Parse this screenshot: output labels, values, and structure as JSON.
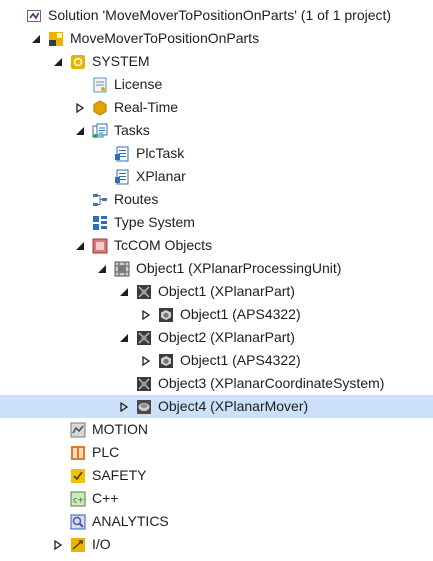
{
  "tree": [
    {
      "name": "tree-item-solution",
      "label": "Solution 'MoveMoverToPositionOnParts' (1 of 1 project)",
      "icon": "solution-icon",
      "expander": "none",
      "depth": 0,
      "selected": false
    },
    {
      "name": "tree-item-project",
      "label": "MoveMoverToPositionOnParts",
      "icon": "twincat-project-icon",
      "expander": "expanded",
      "depth": 1,
      "selected": false
    },
    {
      "name": "tree-item-system",
      "label": "SYSTEM",
      "icon": "system-icon",
      "expander": "expanded",
      "depth": 2,
      "selected": false
    },
    {
      "name": "tree-item-license",
      "label": "License",
      "icon": "license-icon",
      "expander": "none",
      "depth": 3,
      "selected": false
    },
    {
      "name": "tree-item-real-time",
      "label": "Real-Time",
      "icon": "realtime-icon",
      "expander": "collapsed",
      "depth": 3,
      "selected": false
    },
    {
      "name": "tree-item-tasks",
      "label": "Tasks",
      "icon": "tasks-icon",
      "expander": "expanded",
      "depth": 3,
      "selected": false
    },
    {
      "name": "tree-item-plctask",
      "label": "PlcTask",
      "icon": "task-icon",
      "expander": "none",
      "depth": 4,
      "selected": false
    },
    {
      "name": "tree-item-xplanar-task",
      "label": "XPlanar",
      "icon": "task-icon",
      "expander": "none",
      "depth": 4,
      "selected": false
    },
    {
      "name": "tree-item-routes",
      "label": "Routes",
      "icon": "routes-icon",
      "expander": "none",
      "depth": 3,
      "selected": false
    },
    {
      "name": "tree-item-type-system",
      "label": "Type System",
      "icon": "type-system-icon",
      "expander": "none",
      "depth": 3,
      "selected": false
    },
    {
      "name": "tree-item-tccom-objects",
      "label": "TcCOM Objects",
      "icon": "tccom-icon",
      "expander": "expanded",
      "depth": 3,
      "selected": false
    },
    {
      "name": "tree-item-processing-unit",
      "label": "Object1 (XPlanarProcessingUnit)",
      "icon": "processing-unit-icon",
      "expander": "expanded",
      "depth": 4,
      "selected": false
    },
    {
      "name": "tree-item-part-1",
      "label": "Object1 (XPlanarPart)",
      "icon": "part-icon",
      "expander": "expanded",
      "depth": 5,
      "selected": false
    },
    {
      "name": "tree-item-part-1-aps",
      "label": "Object1 (APS4322)",
      "icon": "aps-icon",
      "expander": "collapsed",
      "depth": 6,
      "selected": false
    },
    {
      "name": "tree-item-part-2",
      "label": "Object2 (XPlanarPart)",
      "icon": "part-icon",
      "expander": "expanded",
      "depth": 5,
      "selected": false
    },
    {
      "name": "tree-item-part-2-aps",
      "label": "Object1 (APS4322)",
      "icon": "aps-icon",
      "expander": "collapsed",
      "depth": 6,
      "selected": false
    },
    {
      "name": "tree-item-coordinate-system",
      "label": "Object3 (XPlanarCoordinateSystem)",
      "icon": "part-icon",
      "expander": "none",
      "depth": 5,
      "selected": false
    },
    {
      "name": "tree-item-mover",
      "label": "Object4 (XPlanarMover)",
      "icon": "mover-icon",
      "expander": "collapsed",
      "depth": 5,
      "selected": true
    },
    {
      "name": "tree-item-motion",
      "label": "MOTION",
      "icon": "motion-icon",
      "expander": "none",
      "depth": 2,
      "selected": false
    },
    {
      "name": "tree-item-plc",
      "label": "PLC",
      "icon": "plc-icon",
      "expander": "none",
      "depth": 2,
      "selected": false
    },
    {
      "name": "tree-item-safety",
      "label": "SAFETY",
      "icon": "safety-icon",
      "expander": "none",
      "depth": 2,
      "selected": false
    },
    {
      "name": "tree-item-cpp",
      "label": "C++",
      "icon": "cpp-icon",
      "expander": "none",
      "depth": 2,
      "selected": false
    },
    {
      "name": "tree-item-analytics",
      "label": "ANALYTICS",
      "icon": "analytics-icon",
      "expander": "none",
      "depth": 2,
      "selected": false
    },
    {
      "name": "tree-item-io",
      "label": "I/O",
      "icon": "io-icon",
      "expander": "collapsed",
      "depth": 2,
      "selected": false
    }
  ],
  "colors": {
    "selection": "#cce0f9",
    "text": "#1e1e1e",
    "expander": "#1e1e1e"
  }
}
